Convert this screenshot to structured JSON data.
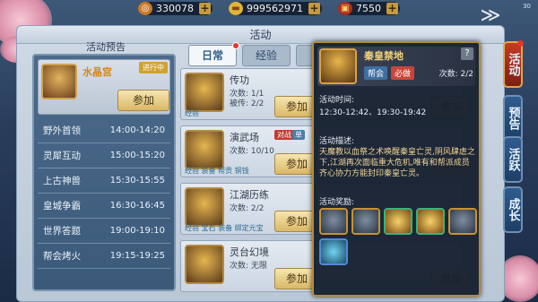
{
  "currency": [
    {
      "name": "coin",
      "icon": "coin-icon",
      "value": "330078"
    },
    {
      "name": "ingot",
      "icon": "gold-ingot-icon",
      "value": "999562971"
    },
    {
      "name": "treasure",
      "icon": "treasure-chest-icon",
      "value": "7550"
    }
  ],
  "corner_badge": "30",
  "window_title": "活动",
  "left_panel": {
    "header": "活动预告",
    "feature": {
      "name": "水晶宫",
      "tag": "进行中",
      "button": "参加"
    },
    "schedule": [
      {
        "name": "野外首领",
        "time": "14:00-14:20"
      },
      {
        "name": "灵犀互动",
        "time": "15:00-15:20"
      },
      {
        "name": "上古神兽",
        "time": "15:30-15:55"
      },
      {
        "name": "皇城争霸",
        "time": "16:30-16:45"
      },
      {
        "name": "世界答题",
        "time": "19:00-19:10"
      },
      {
        "name": "帮会烤火",
        "time": "19:15-19:25"
      }
    ]
  },
  "tabs": [
    {
      "label": "日常",
      "active": true
    },
    {
      "label": "经验",
      "active": false
    },
    {
      "label": "",
      "active": false
    }
  ],
  "cards": [
    {
      "name": "传功",
      "l1": "次数: 1/1",
      "l2": "被传: 2/2",
      "sub": "经验",
      "button": "参加",
      "kind": "",
      "kind2": ""
    },
    {
      "name": "演武场",
      "l1": "次数: 10/10",
      "l2": "",
      "sub": "经验 装备 帮贡 铜钱",
      "button": "参加",
      "kind": "对战",
      "kind2": "单"
    },
    {
      "name": "江湖历练",
      "l1": "次数: 2/2",
      "l2": "",
      "sub": "经验 宝石 装备 绑定元宝",
      "button": "参加",
      "kind": "",
      "kind2": ""
    },
    {
      "name": "灵台幻境",
      "l1": "次数: 无限",
      "l2": "",
      "sub": "",
      "button": "参加",
      "kind": "",
      "kind2": ""
    }
  ],
  "right_buttons": [
    "参加",
    "参加",
    "参加",
    "参加"
  ],
  "tooltip": {
    "name": "秦皇禁地",
    "badge1": "帮会",
    "badge2": "必做",
    "count": "次数: 2/2",
    "help": "?",
    "time_label": "活动时间:",
    "time_value": "12:30-12:42、19:30-19:42",
    "desc_label": "活动描述:",
    "desc_text": "天魔教以血祭之术唤醒秦皇亡灵,阴风肆虐之下,江湖再次面临重大危机,唯有和帮派成员齐心协力方能封印秦皇亡灵。",
    "reward_label": "活动奖励:",
    "rewards": [
      "armor-icon",
      "sword-icon",
      "gold-medal-icon",
      "gold-ingot-icon",
      "scroll-icon",
      "gem-icon"
    ]
  },
  "side_tabs": [
    {
      "label": "活动",
      "active": true
    },
    {
      "label": "预告",
      "active": false
    },
    {
      "label": "活跃",
      "active": false
    },
    {
      "label": "成长",
      "active": false
    }
  ]
}
